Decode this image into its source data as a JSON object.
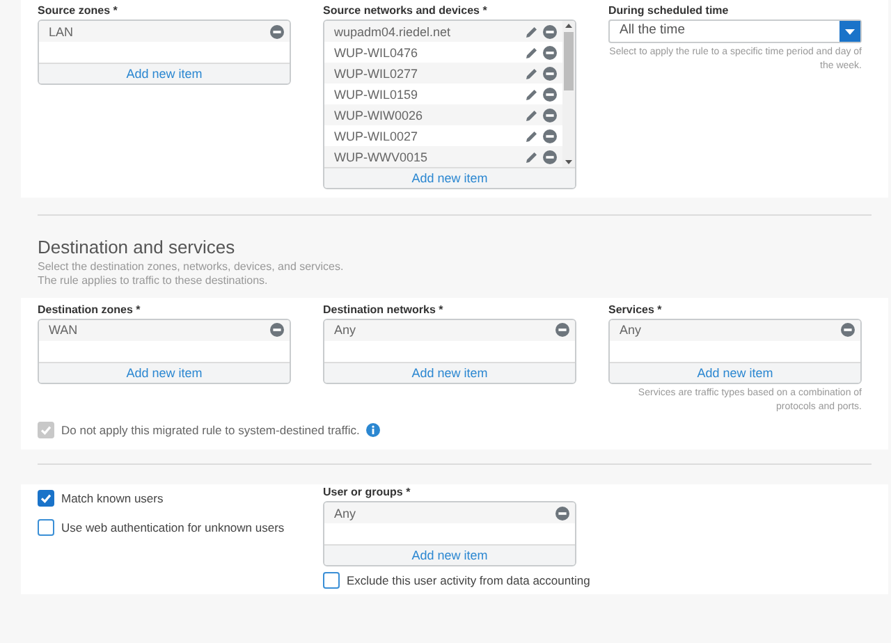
{
  "source_zones": {
    "label": "Source zones *",
    "items": [
      {
        "text": "LAN",
        "editable": false
      }
    ],
    "add_button": "Add new item"
  },
  "source_networks": {
    "label": "Source networks and devices *",
    "items": [
      {
        "text": "wupadm04.riedel.net",
        "editable": true
      },
      {
        "text": "WUP-WIL0476",
        "editable": true
      },
      {
        "text": "WUP-WIL0277",
        "editable": true
      },
      {
        "text": "WUP-WIL0159",
        "editable": true
      },
      {
        "text": "WUP-WIW0026",
        "editable": true
      },
      {
        "text": "WUP-WIL0027",
        "editable": true
      },
      {
        "text": "WUP-WWV0015",
        "editable": true
      }
    ],
    "add_button": "Add new item"
  },
  "schedule": {
    "label": "During scheduled time",
    "value": "All the time",
    "hint": "Select to apply the rule to a specific time period and day of the week."
  },
  "destination": {
    "title": "Destination and services",
    "description": [
      "Select the destination zones, networks, devices, and services.",
      "The rule applies to traffic to these destinations."
    ]
  },
  "destination_zones": {
    "label": "Destination zones *",
    "items": [
      {
        "text": "WAN",
        "editable": false
      }
    ],
    "add_button": "Add new item"
  },
  "destination_networks": {
    "label": "Destination networks *",
    "items": [
      {
        "text": "Any",
        "editable": false
      }
    ],
    "add_button": "Add new item"
  },
  "services": {
    "label": "Services *",
    "items": [
      {
        "text": "Any",
        "editable": false
      }
    ],
    "add_button": "Add new item",
    "hint": "Services are traffic types based on a combination of protocols and ports."
  },
  "system_traffic": {
    "label": "Do not apply this migrated rule to system-destined traffic.",
    "checked": true,
    "disabled": true
  },
  "users": {
    "options": [
      {
        "label": "Match known users",
        "checked": true
      },
      {
        "label": "Use web authentication for unknown users",
        "checked": false
      }
    ],
    "groups": {
      "label": "User or groups *",
      "items": [
        {
          "text": "Any",
          "editable": false
        }
      ],
      "add_button": "Add new item"
    },
    "exclude": {
      "label": "Exclude this user activity from data accounting",
      "checked": false
    }
  }
}
